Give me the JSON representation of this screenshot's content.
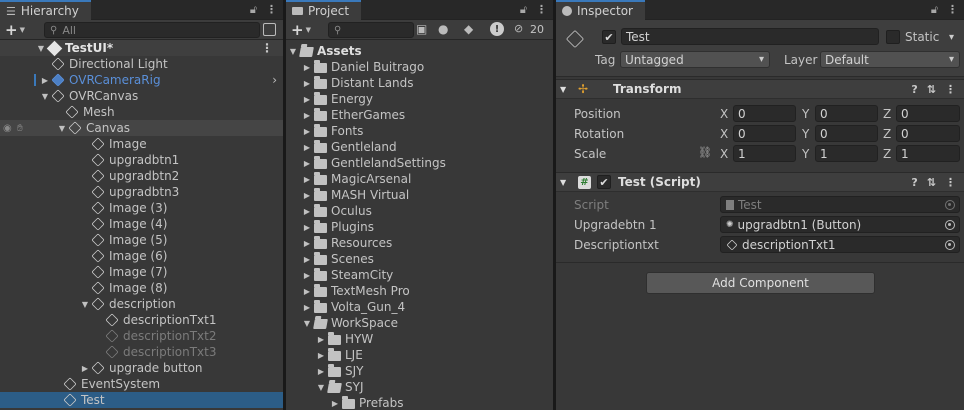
{
  "hierarchy": {
    "tab_label": "Hierarchy",
    "search_placeholder": "All",
    "scene": "TestUI*",
    "items": [
      {
        "label": "Directional Light"
      },
      {
        "label": "OVRCameraRig"
      },
      {
        "label": "OVRCanvas"
      },
      {
        "label": "Mesh"
      },
      {
        "label": "Canvas"
      },
      {
        "label": "Image"
      },
      {
        "label": "upgradbtn1"
      },
      {
        "label": "upgradbtn2"
      },
      {
        "label": "upgradbtn3"
      },
      {
        "label": "Image (3)"
      },
      {
        "label": "Image (4)"
      },
      {
        "label": "Image (5)"
      },
      {
        "label": "Image (6)"
      },
      {
        "label": "Image (7)"
      },
      {
        "label": "Image (8)"
      },
      {
        "label": "description"
      },
      {
        "label": "descriptionTxt1"
      },
      {
        "label": "descriptionTxt2"
      },
      {
        "label": "descriptionTxt3"
      },
      {
        "label": "upgrade button"
      },
      {
        "label": "EventSystem"
      },
      {
        "label": "Test"
      }
    ]
  },
  "project": {
    "tab_label": "Project",
    "hidden_count": "20",
    "root": "Assets",
    "folders": [
      {
        "label": "Daniel Buitrago"
      },
      {
        "label": "Distant Lands"
      },
      {
        "label": "Energy"
      },
      {
        "label": "EtherGames"
      },
      {
        "label": "Fonts"
      },
      {
        "label": "Gentleland"
      },
      {
        "label": "GentlelandSettings"
      },
      {
        "label": "MagicArsenal"
      },
      {
        "label": "MASH Virtual"
      },
      {
        "label": "Oculus"
      },
      {
        "label": "Plugins"
      },
      {
        "label": "Resources"
      },
      {
        "label": "Scenes"
      },
      {
        "label": "SteamCity"
      },
      {
        "label": "TextMesh Pro"
      },
      {
        "label": "Volta_Gun_4"
      },
      {
        "label": "WorkSpace"
      },
      {
        "label": "HYW"
      },
      {
        "label": "LJE"
      },
      {
        "label": "SJY"
      },
      {
        "label": "SYJ"
      },
      {
        "label": "Prefabs"
      }
    ]
  },
  "inspector": {
    "tab_label": "Inspector",
    "object_name": "Test",
    "static_label": "Static",
    "tag_label": "Tag",
    "tag_value": "Untagged",
    "layer_label": "Layer",
    "layer_value": "Default",
    "transform": {
      "title": "Transform",
      "position_label": "Position",
      "rotation_label": "Rotation",
      "scale_label": "Scale",
      "x_label": "X",
      "y_label": "Y",
      "z_label": "Z",
      "position": {
        "x": "0",
        "y": "0",
        "z": "0"
      },
      "rotation": {
        "x": "0",
        "y": "0",
        "z": "0"
      },
      "scale": {
        "x": "1",
        "y": "1",
        "z": "1"
      }
    },
    "script_component": {
      "title": "Test (Script)",
      "script_label": "Script",
      "script_value": "Test",
      "field1_label": "Upgradebtn 1",
      "field1_value": "upgradbtn1 (Button)",
      "field2_label": "Descriptiontxt",
      "field2_value": "descriptionTxt1"
    },
    "add_component_label": "Add Component"
  },
  "colors": {
    "accent": "#3a79bb",
    "selection": "#2c5d87",
    "panel": "#383838",
    "header": "#3e3e3e"
  }
}
